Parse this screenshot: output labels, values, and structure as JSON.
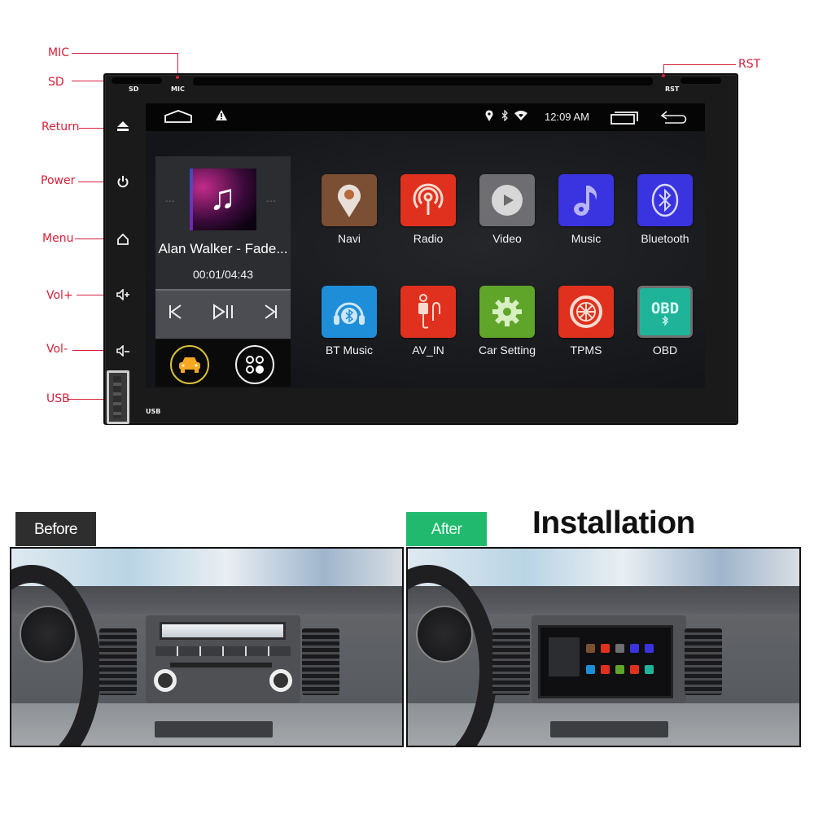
{
  "callouts": {
    "mic": "MIC",
    "sd": "SD",
    "return": "Return",
    "power": "Power",
    "menu": "Menu",
    "vol_up": "Vol+",
    "vol_down": "Vol-",
    "usb": "USB",
    "rst": "RST"
  },
  "unit_labels": {
    "sd": "SD",
    "mic": "MIC",
    "rst": "RST",
    "usb": "USB"
  },
  "status_bar": {
    "time": "12:09 AM",
    "icons": [
      "home-outline-icon",
      "warning-icon",
      "location-icon",
      "bluetooth-icon",
      "wifi-icon",
      "recent-apps-icon",
      "back-icon"
    ]
  },
  "player": {
    "track": "Alan Walker - Fade...",
    "time": "00:01/04:43",
    "controls": [
      "previous",
      "play-pause",
      "next"
    ]
  },
  "apps": [
    {
      "label": "Navi",
      "icon": "map-pin-icon",
      "color": "#7a4f34"
    },
    {
      "label": "Radio",
      "icon": "radio-broadcast-icon",
      "color": "#e0301e"
    },
    {
      "label": "Video",
      "icon": "play-icon",
      "color": "#6e6e72"
    },
    {
      "label": "Music",
      "icon": "music-note-icon",
      "color": "#3a33e0"
    },
    {
      "label": "Bluetooth",
      "icon": "bluetooth-icon",
      "color": "#3a33e0"
    },
    {
      "label": "BT Music",
      "icon": "headphones-bluetooth-icon",
      "color": "#1e8ed8"
    },
    {
      "label": "AV_IN",
      "icon": "av-cable-icon",
      "color": "#e0301e"
    },
    {
      "label": "Car Setting",
      "icon": "gear-icon",
      "color": "#5fa52a"
    },
    {
      "label": "TPMS",
      "icon": "tire-icon",
      "color": "#e0301e"
    },
    {
      "label": "OBD",
      "icon": "obd-icon",
      "color": "#1fb49a"
    }
  ],
  "installation": {
    "title": "Installation",
    "before_label": "Before",
    "after_label": "After",
    "before_color": "#2e2e2e",
    "after_color": "#21b96e"
  },
  "colors": {
    "callout": "#d6203a"
  }
}
